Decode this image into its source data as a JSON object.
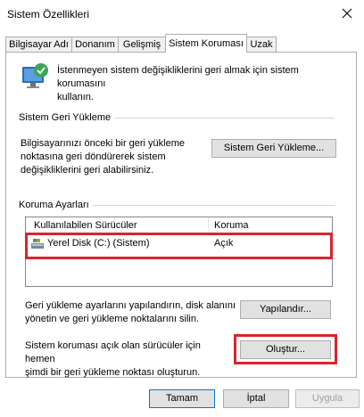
{
  "window": {
    "title": "Sistem Özellikleri"
  },
  "tabs": [
    {
      "label": "Bilgisayar Adı"
    },
    {
      "label": "Donanım"
    },
    {
      "label": "Gelişmiş"
    },
    {
      "label": "Sistem Koruması",
      "active": true
    },
    {
      "label": "Uzak"
    }
  ],
  "intro": {
    "line1": "İstenmeyen sistem değişikliklerini geri almak için sistem korumasını",
    "line2": "kullanın.",
    "icon": "system-protection-icon"
  },
  "restore": {
    "group_label": "Sistem Geri Yükleme",
    "desc_line1": "Bilgisayarınızı önceki bir geri yükleme",
    "desc_line2": "noktasına geri döndürerek sistem",
    "desc_line3": "değişikliklerini geri alabilirsiniz.",
    "button_label": "Sistem Geri Yükleme..."
  },
  "protection": {
    "group_label": "Koruma Ayarları",
    "columns": [
      "Kullanılabilen Sürücüler",
      "Koruma"
    ],
    "drives": [
      {
        "name": "Yerel Disk (C:) (Sistem)",
        "status": "Açık",
        "icon": "drive-icon"
      }
    ],
    "configure_desc_line1": "Geri yükleme ayarlarını yapılandırın, disk alanını",
    "configure_desc_line2": "yönetin ve geri yükleme noktalarını silin.",
    "configure_button": "Yapılandır...",
    "create_desc_line1": "Sistem koruması açık olan sürücüler için hemen",
    "create_desc_line2": "şimdi bir geri yükleme noktası oluşturun.",
    "create_button": "Oluştur..."
  },
  "footer": {
    "ok": "Tamam",
    "cancel": "İptal",
    "apply": "Uygula"
  },
  "colors": {
    "highlight": "#d7252e",
    "accent": "#0078d7"
  }
}
